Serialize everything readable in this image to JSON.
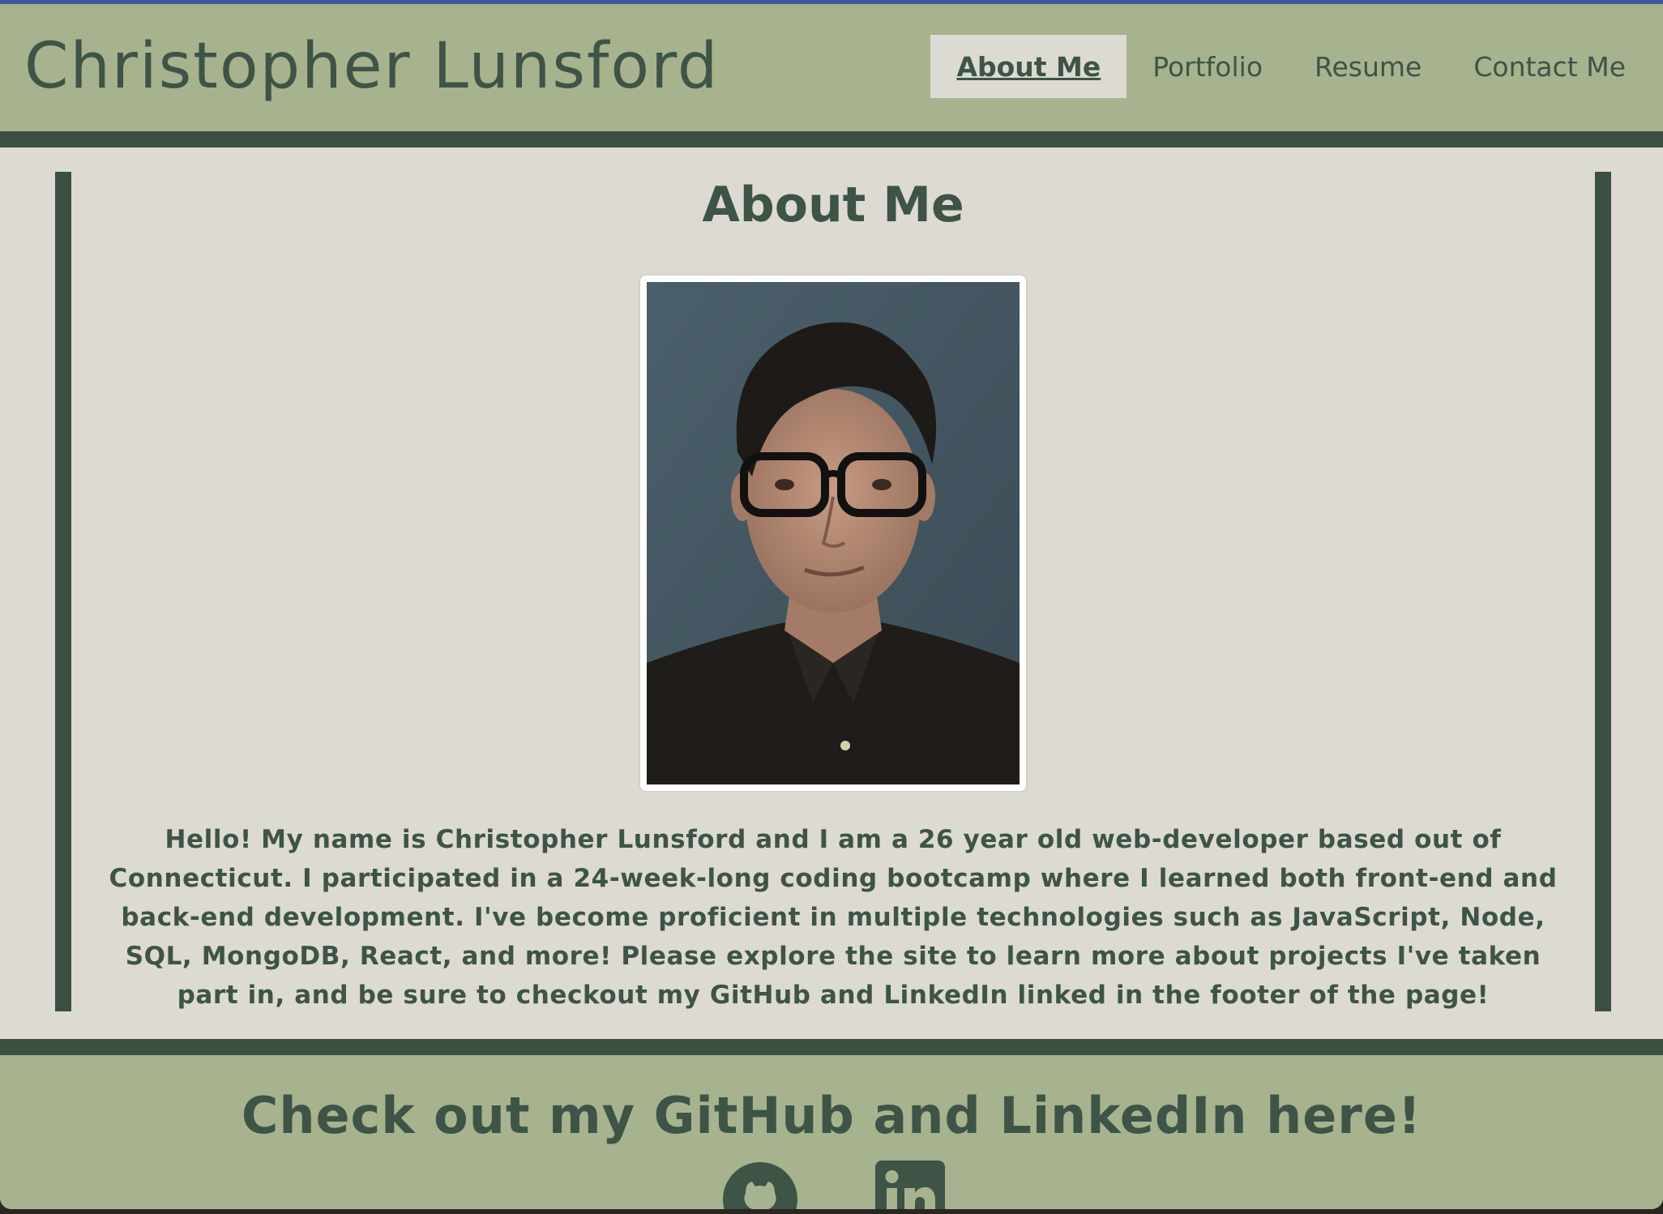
{
  "header": {
    "site_title": "Christopher Lunsford",
    "nav": [
      {
        "label": "About Me",
        "active": true
      },
      {
        "label": "Portfolio",
        "active": false
      },
      {
        "label": "Resume",
        "active": false
      },
      {
        "label": "Contact Me",
        "active": false
      }
    ]
  },
  "main": {
    "heading": "About Me",
    "portrait_icon": "portrait-photo",
    "bio": "Hello! My name is Christopher Lunsford and I am a 26 year old web-developer based out of Connecticut. I participated in a 24-week-long coding bootcamp where I learned both front-end and back-end development. I've become proficient in multiple technologies such as JavaScript, Node, SQL, MongoDB, React, and more! Please explore the site to learn more about projects I've taken part in, and be sure to checkout my GitHub and LinkedIn linked in the footer of the page!"
  },
  "footer": {
    "heading": "Check out my GitHub and LinkedIn here!",
    "links": [
      {
        "icon": "github-icon"
      },
      {
        "icon": "linkedin-icon"
      }
    ]
  },
  "colors": {
    "header_bg": "#a6b38e",
    "page_bg": "#dcdad2",
    "dark_green": "#3b4f42",
    "text_green": "#3d5446"
  }
}
